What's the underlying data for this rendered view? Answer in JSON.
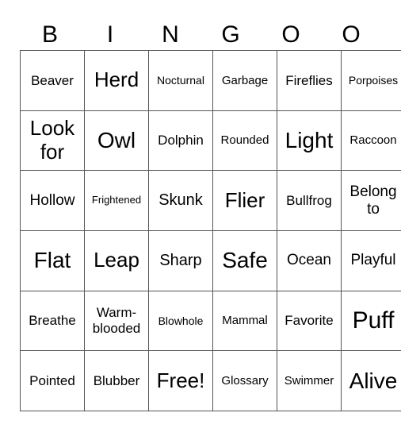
{
  "header": [
    "B",
    "I",
    "N",
    "G",
    "O",
    "O"
  ],
  "rows": [
    [
      "Beaver",
      "Herd",
      "Nocturnal",
      "Garbage",
      "Fireflies",
      "Porpoises"
    ],
    [
      "Look for",
      "Owl",
      "Dolphin",
      "Rounded",
      "Light",
      "Raccoon"
    ],
    [
      "Hollow",
      "Frightened",
      "Skunk",
      "Flier",
      "Bullfrog",
      "Belong to"
    ],
    [
      "Flat",
      "Leap",
      "Sharp",
      "Safe",
      "Ocean",
      "Playful"
    ],
    [
      "Breathe",
      "Warm-blooded",
      "Blowhole",
      "Mammal",
      "Favorite",
      "Puff"
    ],
    [
      "Pointed",
      "Blubber",
      "Free!",
      "Glossary",
      "Swimmer",
      "Alive"
    ]
  ]
}
